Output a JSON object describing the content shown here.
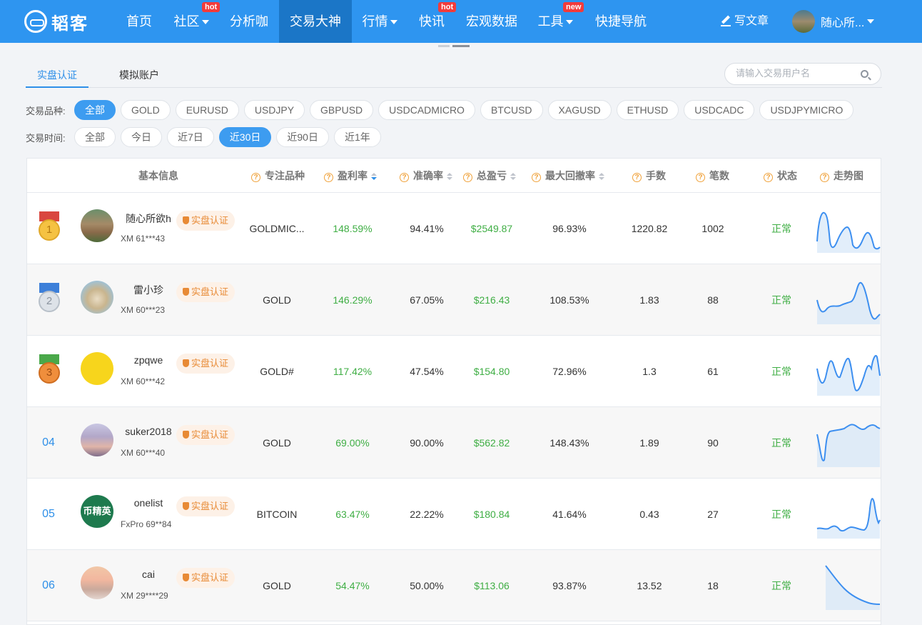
{
  "nav": {
    "logo_text": "韬客",
    "items": [
      {
        "label": "首页",
        "badge": ""
      },
      {
        "label": "社区",
        "badge": "hot"
      },
      {
        "label": "分析咖",
        "badge": ""
      },
      {
        "label": "交易大神",
        "badge": ""
      },
      {
        "label": "行情",
        "badge": ""
      },
      {
        "label": "快讯",
        "badge": "hot"
      },
      {
        "label": "宏观数据",
        "badge": ""
      },
      {
        "label": "工具",
        "badge": "new"
      },
      {
        "label": "快捷导航",
        "badge": ""
      }
    ],
    "active_item": "交易大神",
    "write_label": "写文章",
    "user_name": "随心所..."
  },
  "tabs": {
    "items": [
      "实盘认证",
      "模拟账户"
    ],
    "active": "实盘认证"
  },
  "search": {
    "placeholder": "请输入交易用户名"
  },
  "filters": {
    "symbol_label": "交易品种:",
    "symbols": [
      "全部",
      "GOLD",
      "EURUSD",
      "USDJPY",
      "GBPUSD",
      "USDCADMICRO",
      "BTCUSD",
      "XAGUSD",
      "ETHUSD",
      "USDCADC",
      "USDJPYMICRO"
    ],
    "symbol_active": "全部",
    "time_label": "交易时间:",
    "times": [
      "全部",
      "今日",
      "近7日",
      "近30日",
      "近90日",
      "近1年"
    ],
    "time_active": "近30日"
  },
  "table": {
    "headers": {
      "basic": "基本信息",
      "symbol": "专注品种",
      "profit_rate": "盈利率",
      "accuracy": "准确率",
      "total_pl": "总盈亏",
      "max_drawdown": "最大回撤率",
      "lots": "手数",
      "trades": "笔数",
      "status": "状态",
      "trend": "走势图"
    },
    "verify_label": "实盘认证",
    "rows": [
      {
        "rank": "1",
        "name": "随心所欲h",
        "account": "XM 61***43",
        "symbol": "GOLDMIC...",
        "profit_rate": "148.59%",
        "accuracy": "94.41%",
        "total_pl": "$2549.87",
        "max_drawdown": "96.93%",
        "lots": "1220.82",
        "trades": "1002",
        "status": "正常"
      },
      {
        "rank": "2",
        "name": "雷小珍",
        "account": "XM 60***23",
        "symbol": "GOLD",
        "profit_rate": "146.29%",
        "accuracy": "67.05%",
        "total_pl": "$216.43",
        "max_drawdown": "108.53%",
        "lots": "1.83",
        "trades": "88",
        "status": "正常"
      },
      {
        "rank": "3",
        "name": "zpqwe",
        "account": "XM 60***42",
        "symbol": "GOLD#",
        "profit_rate": "117.42%",
        "accuracy": "47.54%",
        "total_pl": "$154.80",
        "max_drawdown": "72.96%",
        "lots": "1.3",
        "trades": "61",
        "status": "正常"
      },
      {
        "rank": "04",
        "name": "suker2018",
        "account": "XM 60***40",
        "symbol": "GOLD",
        "profit_rate": "69.00%",
        "accuracy": "90.00%",
        "total_pl": "$562.82",
        "max_drawdown": "148.43%",
        "lots": "1.89",
        "trades": "90",
        "status": "正常"
      },
      {
        "rank": "05",
        "name": "onelist",
        "account": "FxPro 69**84",
        "symbol": "BITCOIN",
        "profit_rate": "63.47%",
        "accuracy": "22.22%",
        "total_pl": "$180.84",
        "max_drawdown": "41.64%",
        "lots": "0.43",
        "trades": "27",
        "status": "正常"
      },
      {
        "rank": "06",
        "name": "cai",
        "account": "XM 29****29",
        "symbol": "GOLD",
        "profit_rate": "54.47%",
        "accuracy": "50.00%",
        "total_pl": "$113.06",
        "max_drawdown": "93.87%",
        "lots": "13.52",
        "trades": "18",
        "status": "正常"
      }
    ]
  },
  "avatar_texts": {
    "row5": "币精英"
  },
  "colors": {
    "nav_bg": "#2e95f0",
    "nav_active": "#1b76c7",
    "accent": "#2e8fe8",
    "profit_green": "#3fae44",
    "badge_red": "#f23b3b",
    "verify_orange": "#e88a35",
    "gold_medal": "#f5c242",
    "silver_medal": "#cdd3d9",
    "bronze_medal": "#e98a3a"
  }
}
